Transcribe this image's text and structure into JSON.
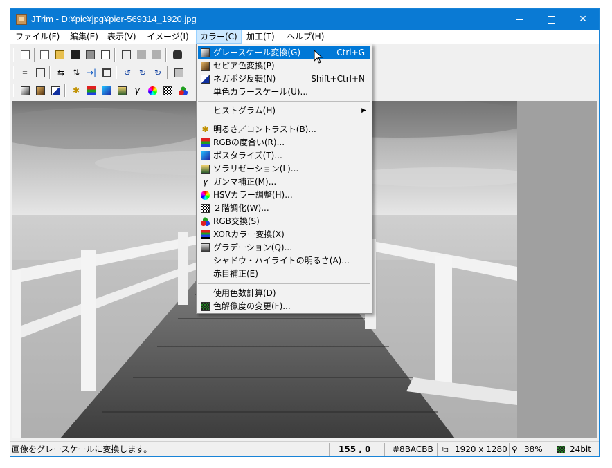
{
  "window": {
    "title": "JTrim - D:¥pic¥jpg¥pier-569314_1920.jpg",
    "accent": "#0a7ad4"
  },
  "menubar": {
    "items": [
      {
        "label": "ファイル(F)"
      },
      {
        "label": "編集(E)"
      },
      {
        "label": "表示(V)"
      },
      {
        "label": "イメージ(I)"
      },
      {
        "label": "カラー(C)"
      },
      {
        "label": "加工(T)"
      },
      {
        "label": "ヘルプ(H)"
      }
    ],
    "active": "カラー(C)"
  },
  "color_menu": {
    "items": [
      {
        "label": "グレースケール変換(G)",
        "shortcut": "Ctrl+G",
        "icon": "grayscale-icon",
        "highlighted": true
      },
      {
        "label": "セピア色変換(P)",
        "shortcut": "",
        "icon": "sepia-icon"
      },
      {
        "label": "ネガポジ反転(N)",
        "shortcut": "Shift+Ctrl+N",
        "icon": "negative-icon"
      },
      {
        "label": "単色カラースケール(U)...",
        "shortcut": "",
        "icon": ""
      },
      {
        "label": "ヒストグラム(H)",
        "shortcut": "",
        "icon": "",
        "submenu": true
      },
      {
        "label": "明るさ／コントラスト(B)...",
        "shortcut": "",
        "icon": "brightness-icon"
      },
      {
        "label": "RGBの度合い(R)...",
        "shortcut": "",
        "icon": "rgb-level-icon"
      },
      {
        "label": "ポスタライズ(T)...",
        "shortcut": "",
        "icon": "posterize-icon"
      },
      {
        "label": "ソラリゼーション(L)...",
        "shortcut": "",
        "icon": "solarize-icon"
      },
      {
        "label": "ガンマ補正(M)...",
        "shortcut": "",
        "icon": "gamma-icon"
      },
      {
        "label": "HSVカラー調整(H)...",
        "shortcut": "",
        "icon": "hsv-icon"
      },
      {
        "label": "２階調化(W)...",
        "shortcut": "",
        "icon": "binarize-icon"
      },
      {
        "label": "RGB交換(S)",
        "shortcut": "",
        "icon": "rgb-swap-icon"
      },
      {
        "label": "XORカラー変換(X)",
        "shortcut": "",
        "icon": "xor-icon"
      },
      {
        "label": "グラデーション(Q)...",
        "shortcut": "",
        "icon": "gradation-icon"
      },
      {
        "label": "シャドウ・ハイライトの明るさ(A)...",
        "shortcut": "",
        "icon": ""
      },
      {
        "label": "赤目補正(E)",
        "shortcut": "",
        "icon": ""
      },
      {
        "label": "使用色数計算(D)",
        "shortcut": "",
        "icon": ""
      },
      {
        "label": "色解像度の変更(F)...",
        "shortcut": "",
        "icon": "color-depth-icon"
      }
    ]
  },
  "statusbar": {
    "message": "画像をグレースケールに変換します。",
    "coords": "155 , 0",
    "color_value": "#8BACBB",
    "image_size": "1920 x 1280",
    "zoom": "38%",
    "bit_depth": "24bit"
  }
}
